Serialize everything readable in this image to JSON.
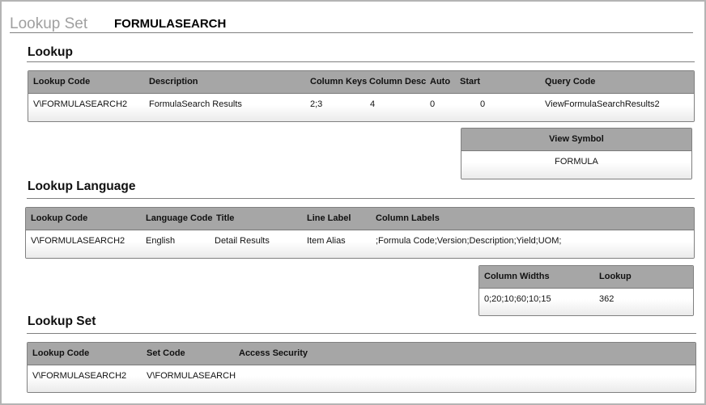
{
  "header": {
    "title": "Lookup Set",
    "name": "FORMULASEARCH"
  },
  "lookup": {
    "heading": "Lookup",
    "columns": [
      "Lookup Code",
      "Description",
      "Column Keys",
      "Column Desc",
      "Auto",
      "Start",
      "Query Code"
    ],
    "row": [
      "V\\FORMULASEARCH2",
      "FormulaSearch Results",
      "2;3",
      "4",
      "0",
      "0",
      "ViewFormulaSearchResults2"
    ],
    "extra": {
      "columns": [
        "View Symbol"
      ],
      "row": [
        "FORMULA"
      ]
    }
  },
  "language": {
    "heading": "Lookup Language",
    "columns": [
      "Lookup Code",
      "Language Code",
      "Title",
      "Line Label",
      "Column Labels"
    ],
    "row": [
      "V\\FORMULASEARCH2",
      "English",
      "Detail Results",
      "Item Alias",
      ";Formula Code;Version;Description;Yield;UOM;"
    ],
    "extra": {
      "columns": [
        "Column Widths",
        "Lookup"
      ],
      "row": [
        "0;20;10;60;10;15",
        "362"
      ]
    }
  },
  "set": {
    "heading": "Lookup Set",
    "columns": [
      "Lookup Code",
      "Set Code",
      "Access Security"
    ],
    "row": [
      "V\\FORMULASEARCH2",
      "V\\FORMULASEARCH",
      ""
    ]
  },
  "colors": {
    "header_bg": "#a6a6a6",
    "title_gray": "#a0a0a0"
  }
}
